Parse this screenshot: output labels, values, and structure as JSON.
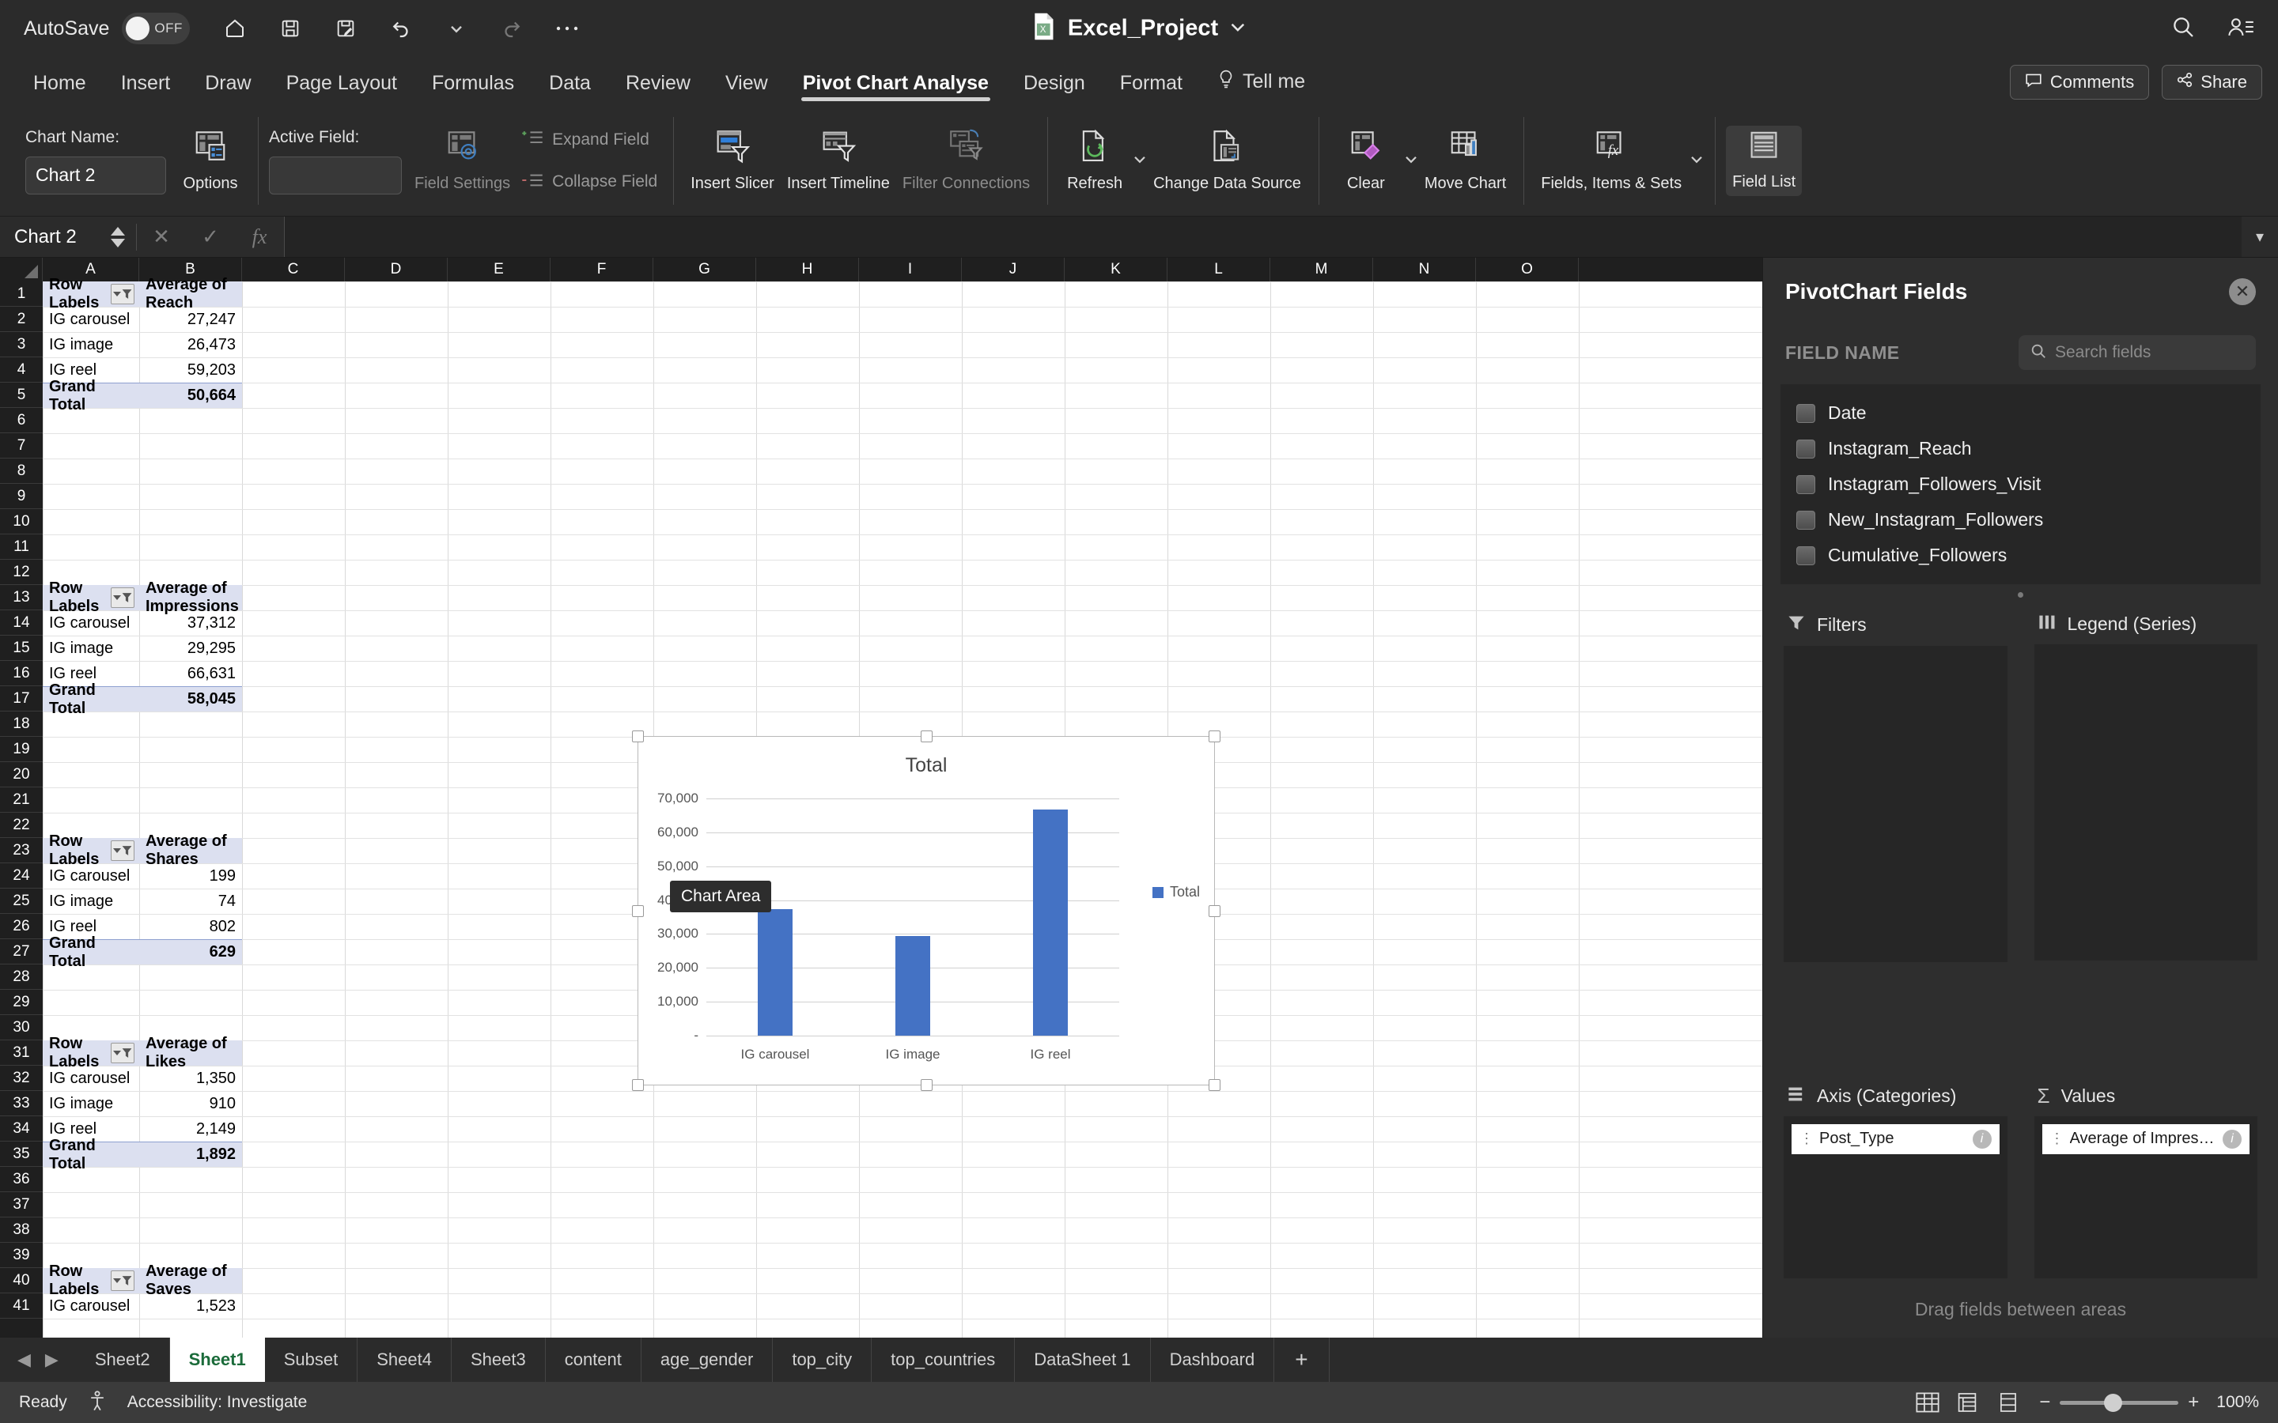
{
  "titlebar": {
    "autosave_label": "AutoSave",
    "autosave_state": "OFF",
    "document_title": "Excel_Project",
    "qat": [
      "home-icon",
      "save-icon",
      "save-as-icon",
      "undo-icon",
      "undo-dropdown-icon",
      "redo-icon",
      "more-icon"
    ],
    "search_icon": "search-icon",
    "account_icon": "account-icon"
  },
  "ribbon_tabs": {
    "items": [
      "Home",
      "Insert",
      "Draw",
      "Page Layout",
      "Formulas",
      "Data",
      "Review",
      "View",
      "Pivot Chart Analyse",
      "Design",
      "Format"
    ],
    "active": "Pivot Chart Analyse",
    "tell_me": "Tell me",
    "comments": "Comments",
    "share": "Share"
  },
  "ribbon": {
    "chart_name_label": "Chart Name:",
    "chart_name_value": "Chart 2",
    "options": "Options",
    "active_field_label": "Active Field:",
    "active_field_value": "",
    "field_settings": "Field Settings",
    "expand_field": "Expand Field",
    "collapse_field": "Collapse Field",
    "insert_slicer": "Insert Slicer",
    "insert_timeline": "Insert Timeline",
    "filter_connections": "Filter Connections",
    "refresh": "Refresh",
    "change_data_source": "Change Data Source",
    "clear": "Clear",
    "move_chart": "Move Chart",
    "fields_items_sets": "Fields, Items & Sets",
    "field_list": "Field List"
  },
  "formula_bar": {
    "name_box": "Chart 2",
    "cancel_icon": "cancel-icon",
    "confirm_icon": "confirm-icon",
    "function_icon": "fx-icon",
    "formula_value": ""
  },
  "grid": {
    "columns": [
      "A",
      "B",
      "C",
      "D",
      "E",
      "F",
      "G",
      "H",
      "I",
      "J",
      "K",
      "L",
      "M",
      "N",
      "O"
    ],
    "rows": [
      1,
      2,
      3,
      4,
      5,
      6,
      7,
      8,
      9,
      10,
      11,
      12,
      13,
      14,
      15,
      16,
      17,
      18,
      19,
      20,
      21,
      22,
      23,
      24,
      25,
      26,
      27,
      28,
      29,
      30,
      31,
      32,
      33,
      34,
      35,
      36,
      37,
      38,
      39,
      40,
      41
    ],
    "pivots": [
      {
        "header_row": 1,
        "label_header": "Row Labels",
        "value_header": "Average of Reach",
        "rows": [
          [
            "IG carousel",
            "27,247"
          ],
          [
            "IG image",
            "26,473"
          ],
          [
            "IG reel",
            "59,203"
          ]
        ],
        "total_label": "Grand Total",
        "total_value": "50,664"
      },
      {
        "header_row": 13,
        "label_header": "Row Labels",
        "value_header": "Average of Impressions",
        "rows": [
          [
            "IG carousel",
            "37,312"
          ],
          [
            "IG image",
            "29,295"
          ],
          [
            "IG reel",
            "66,631"
          ]
        ],
        "total_label": "Grand Total",
        "total_value": "58,045"
      },
      {
        "header_row": 23,
        "label_header": "Row Labels",
        "value_header": "Average of Shares",
        "rows": [
          [
            "IG carousel",
            "199"
          ],
          [
            "IG image",
            "74"
          ],
          [
            "IG reel",
            "802"
          ]
        ],
        "total_label": "Grand Total",
        "total_value": "629"
      },
      {
        "header_row": 31,
        "label_header": "Row Labels",
        "value_header": "Average of Likes",
        "rows": [
          [
            "IG carousel",
            "1,350"
          ],
          [
            "IG image",
            "910"
          ],
          [
            "IG reel",
            "2,149"
          ]
        ],
        "total_label": "Grand Total",
        "total_value": "1,892"
      },
      {
        "header_row": 40,
        "label_header": "Row Labels",
        "value_header": "Average of Saves",
        "rows": [
          [
            "IG carousel",
            "1,523"
          ]
        ],
        "total_label": "",
        "total_value": ""
      }
    ]
  },
  "chart_data": {
    "type": "bar",
    "title": "Total",
    "categories": [
      "IG carousel",
      "IG image",
      "IG reel"
    ],
    "series": [
      {
        "name": "Total",
        "values": [
          37312,
          29295,
          66631
        ]
      }
    ],
    "xlabel": "",
    "ylabel": "",
    "ylim": [
      0,
      70000
    ],
    "ytick_labels": [
      "-",
      "10,000",
      "20,000",
      "30,000",
      "40,000",
      "50,000",
      "60,000",
      "70,000"
    ],
    "ytick_values": [
      0,
      10000,
      20000,
      30000,
      40000,
      50000,
      60000,
      70000
    ],
    "grid": true,
    "legend": "right",
    "legend_entries": [
      "Total"
    ],
    "bar_color": "#4472c4",
    "tooltip": "Chart Area"
  },
  "fields_pane": {
    "title": "PivotChart Fields",
    "close_icon": "close-icon",
    "field_name_label": "FIELD NAME",
    "search_placeholder": "Search fields",
    "search_value": "",
    "fields": [
      "Date",
      "Instagram_Reach",
      "Instagram_Followers_Visit",
      "New_Instagram_Followers",
      "Cumulative_Followers"
    ],
    "zones": [
      {
        "title": "Filters",
        "icon": "filter-icon",
        "chips": []
      },
      {
        "title": "Legend (Series)",
        "icon": "columns-icon",
        "chips": []
      },
      {
        "title": "Axis (Categories)",
        "icon": "rows-icon",
        "chips": [
          "Post_Type"
        ]
      },
      {
        "title": "Values",
        "icon": "sigma-icon",
        "chips": [
          "Average of Impres…"
        ]
      }
    ],
    "drag_hint": "Drag fields between areas"
  },
  "sheet_tabs": {
    "items": [
      "Sheet2",
      "Sheet1",
      "Subset",
      "Sheet4",
      "Sheet3",
      "content",
      "age_gender",
      "top_city",
      "top_countries",
      "DataSheet 1",
      "Dashboard"
    ],
    "active": "Sheet1",
    "add_label": "+"
  },
  "status_bar": {
    "ready": "Ready",
    "accessibility": "Accessibility: Investigate",
    "zoom": "100%"
  }
}
